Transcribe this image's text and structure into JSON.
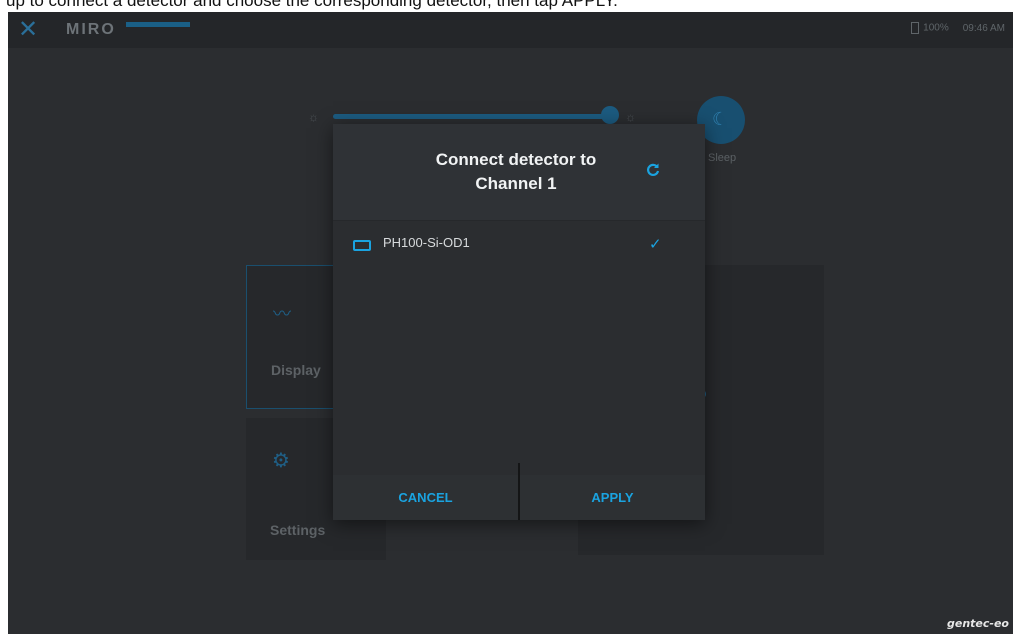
{
  "doc_caption": "up to connect a detector and choose the corresponding detector, then tap APPLY.",
  "topbar": {
    "brand": "MIRO",
    "battery": "100%",
    "time": "09:46 AM"
  },
  "background": {
    "sleep_label": "Sleep",
    "tile_display_label": "Display",
    "tile_settings_label": "Settings"
  },
  "dialog": {
    "title_line1": "Connect detector to",
    "title_line2": "Channel 1",
    "detectors": [
      {
        "name": "PH100-Si-OD1",
        "selected": true
      }
    ],
    "cancel_label": "CANCEL",
    "apply_label": "APPLY"
  },
  "footer_logo": "gentec-eo",
  "colors": {
    "accent": "#1aa3e0",
    "background": "#2b2d30",
    "dialog": "#2f3236"
  }
}
